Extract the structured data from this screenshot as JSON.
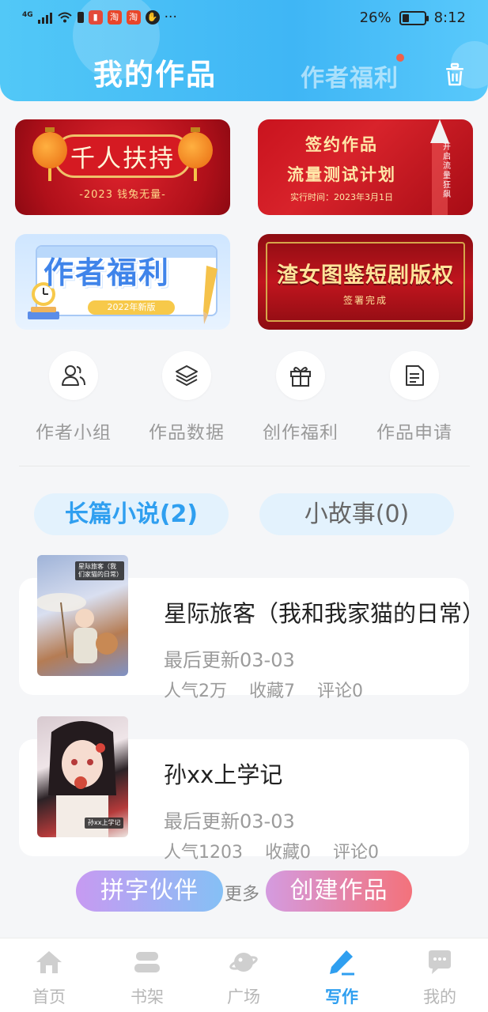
{
  "status_bar": {
    "network": "4G",
    "battery_percent": "26%",
    "time": "8:12",
    "more": "···"
  },
  "header": {
    "title": "我的作品",
    "secondary_tab": "作者福利",
    "has_notification_dot": true
  },
  "banners": [
    {
      "title": "千人扶持",
      "subtitle": "-2023 钱兔无量-"
    },
    {
      "line1": "签约作品",
      "line2": "流量测试计划",
      "line3": "实行时间：2023年3月1日",
      "side_text": "开启流量狂飙"
    },
    {
      "title": "作者福利",
      "badge": "2022年新版"
    },
    {
      "title": "渣女图鉴短剧版权",
      "subtitle": "签署完成"
    }
  ],
  "quick_actions": [
    {
      "label": "作者小组",
      "icon": "group-icon"
    },
    {
      "label": "作品数据",
      "icon": "layers-icon"
    },
    {
      "label": "创作福利",
      "icon": "gift-icon"
    },
    {
      "label": "作品申请",
      "icon": "document-icon"
    }
  ],
  "tabs": [
    {
      "label": "长篇小说(2)",
      "active": true
    },
    {
      "label": "小故事(0)",
      "active": false
    }
  ],
  "works": [
    {
      "title": "星际旅客（我和我家猫的日常）",
      "cover_tag": "星际旅客（我们家猫的日常）",
      "last_update": "最后更新03-03",
      "popularity": "人气2万",
      "favorites": "收藏7",
      "comments": "评论0"
    },
    {
      "title": "孙xx上学记",
      "cover_tag": "孙xx上学记",
      "last_update": "最后更新03-03",
      "popularity": "人气1203",
      "favorites": "收藏0",
      "comments": "评论0"
    }
  ],
  "floating": {
    "left_button": "拼字伙伴",
    "middle_text": "更多",
    "right_button": "创建作品"
  },
  "bottom_nav": [
    {
      "label": "首页",
      "icon": "home-icon",
      "active": false
    },
    {
      "label": "书架",
      "icon": "bookshelf-icon",
      "active": false
    },
    {
      "label": "广场",
      "icon": "planet-icon",
      "active": false
    },
    {
      "label": "写作",
      "icon": "pen-icon",
      "active": true
    },
    {
      "label": "我的",
      "icon": "chat-icon",
      "active": false
    }
  ],
  "colors": {
    "header_blue": "#3fb6f5",
    "accent_blue": "#2f9ff0",
    "tab_bg": "#e3f2fd",
    "notification_red": "#f0604a"
  }
}
